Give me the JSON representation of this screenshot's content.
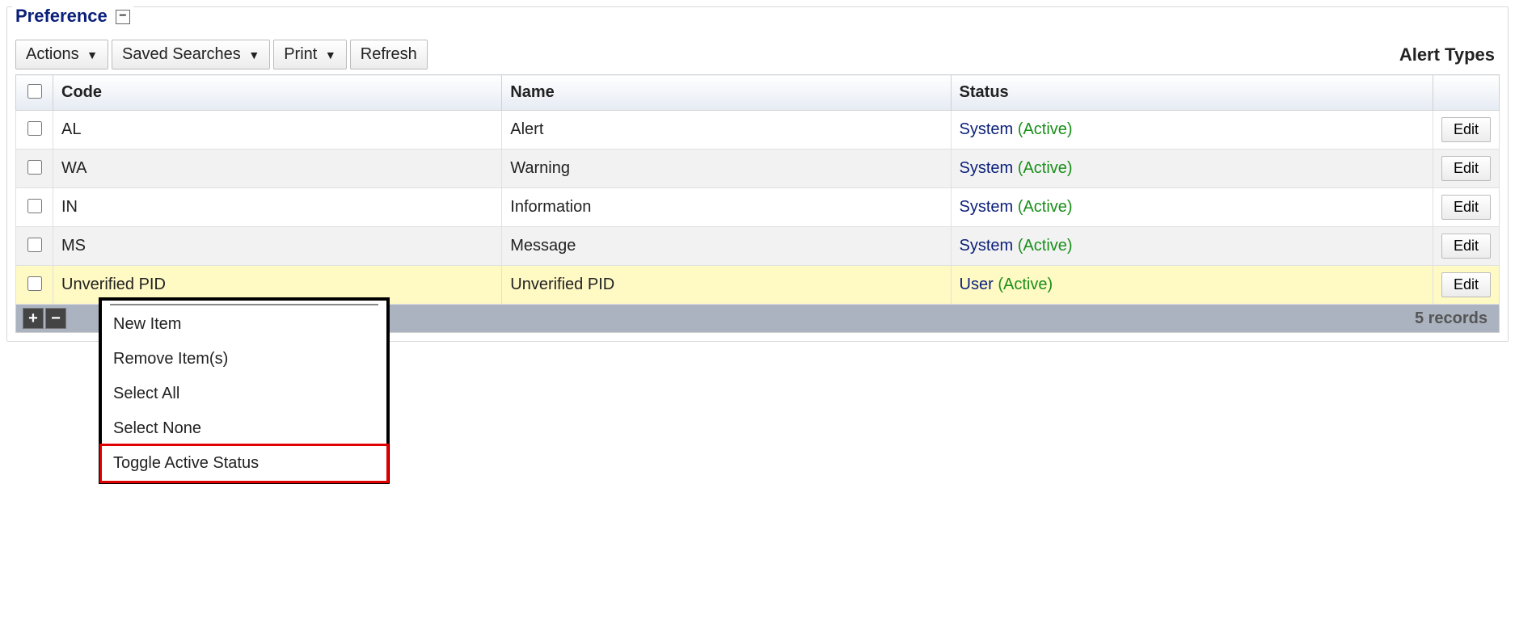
{
  "panel": {
    "title": "Preference"
  },
  "toolbar": {
    "actions_label": "Actions",
    "saved_searches_label": "Saved Searches",
    "print_label": "Print",
    "refresh_label": "Refresh",
    "section_label": "Alert Types"
  },
  "columns": {
    "code": "Code",
    "name": "Name",
    "status": "Status"
  },
  "rows": [
    {
      "code": "AL",
      "name": "Alert",
      "scope": "System",
      "state": "(Active)",
      "edit": "Edit",
      "rowclass": "row-white"
    },
    {
      "code": "WA",
      "name": "Warning",
      "scope": "System",
      "state": "(Active)",
      "edit": "Edit",
      "rowclass": "row-gray"
    },
    {
      "code": "IN",
      "name": "Information",
      "scope": "System",
      "state": "(Active)",
      "edit": "Edit",
      "rowclass": "row-white"
    },
    {
      "code": "MS",
      "name": "Message",
      "scope": "System",
      "state": "(Active)",
      "edit": "Edit",
      "rowclass": "row-gray"
    },
    {
      "code": "Unverified PID",
      "name": "Unverified PID",
      "scope": "User",
      "state": "(Active)",
      "edit": "Edit",
      "rowclass": "row-yellow"
    }
  ],
  "footer": {
    "record_count": "5 records"
  },
  "context_menu": {
    "items": [
      "New Item",
      "Remove Item(s)",
      "Select All",
      "Select None",
      "Toggle Active Status"
    ],
    "highlight_index": 4
  }
}
